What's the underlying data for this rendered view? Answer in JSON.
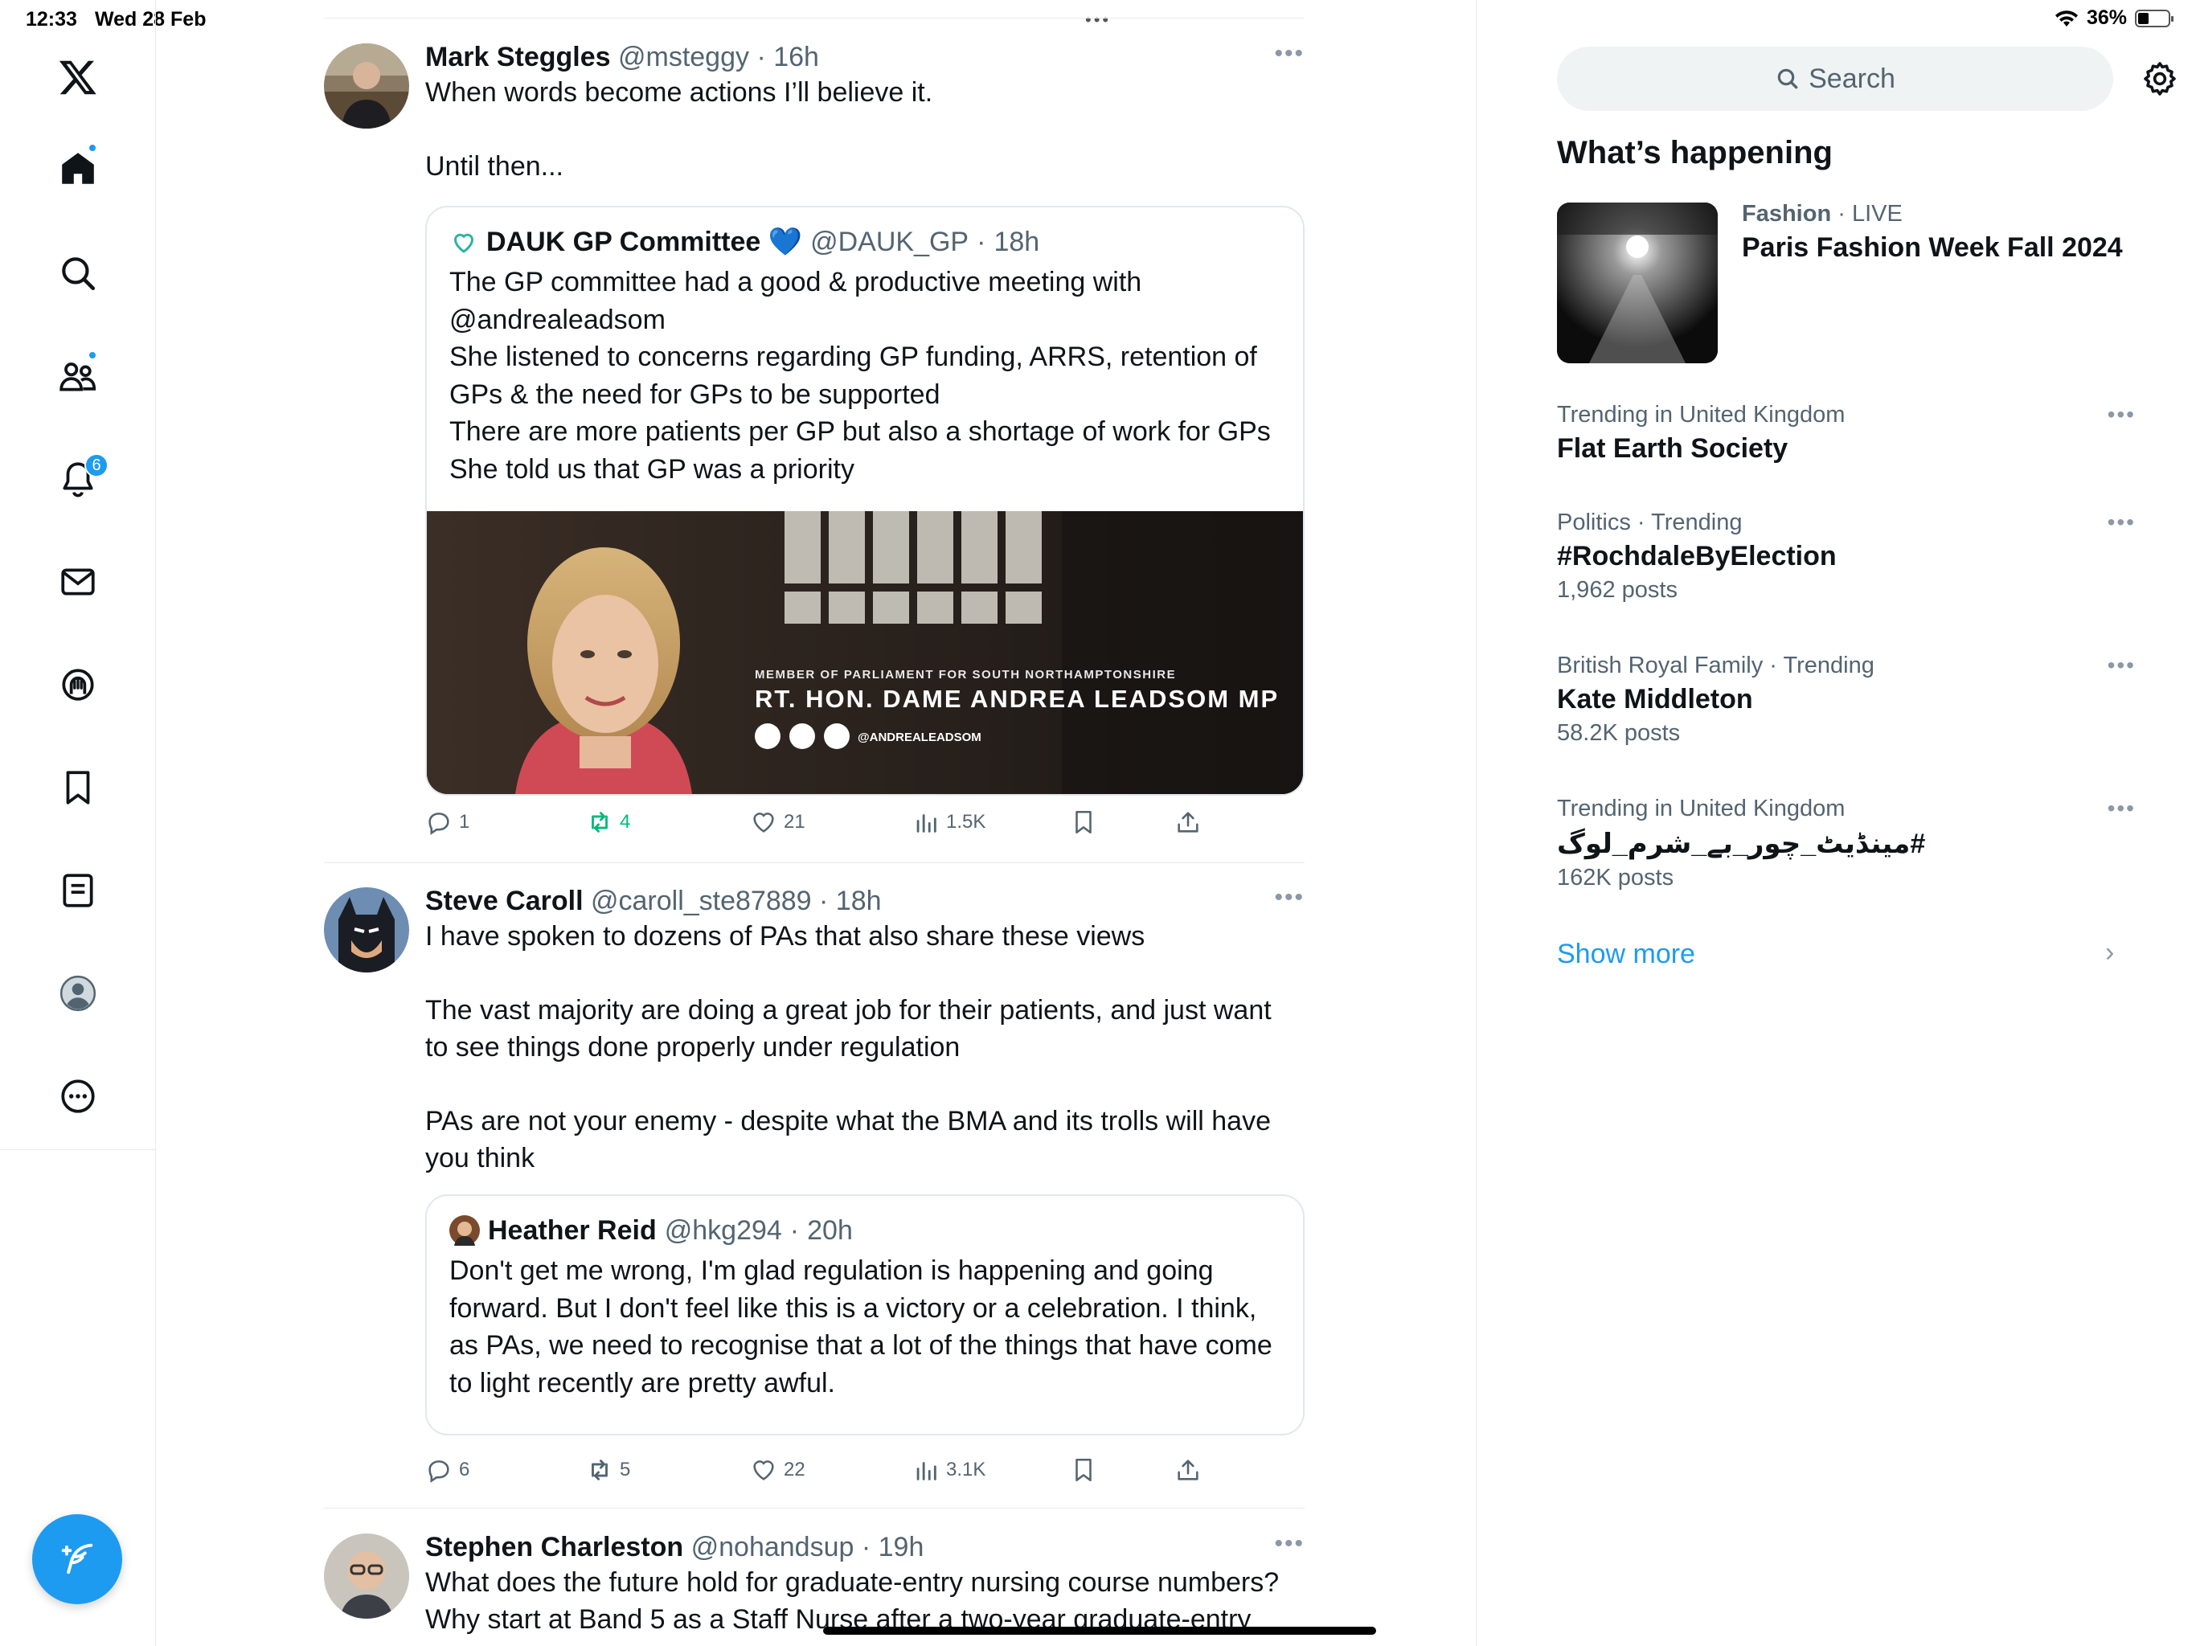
{
  "status_bar": {
    "time": "12:33",
    "date": "Wed 28 Feb",
    "battery": "36%",
    "battery_level": 0.36
  },
  "nav": {
    "items": [
      "x-logo",
      "home",
      "explore",
      "communities",
      "notifications",
      "messages",
      "spaces",
      "bookmarks",
      "lists",
      "profile",
      "more"
    ],
    "notifications_count": "6"
  },
  "feed": {
    "tweets": [
      {
        "name": "Mark Steggles",
        "handle": "@msteggy",
        "time": "16h",
        "text": "When words become actions I’ll believe it.\n\nUntil then...",
        "quote": {
          "name": "DAUK GP Committee 💙",
          "handle": "@DAUK_GP",
          "time": "18h",
          "text": "The GP committee had a good & productive meeting with\n@andrealeadsom\nShe listened to concerns regarding GP funding, ARRS, retention of\nGPs & the need for GPs to be supported\nThere are more patients per GP but also a shortage of work for GPs\nShe told us that GP was a priority",
          "image": {
            "caption_small": "MEMBER OF PARLIAMENT FOR SOUTH NORTHAMPTONSHIRE",
            "caption_big": "RT. HON. DAME ANDREA LEADSOM MP",
            "caption_handle": "@ANDREALEADSOM"
          }
        },
        "replies": "1",
        "reposts": "4",
        "likes": "21",
        "views": "1.5K"
      },
      {
        "name": "Steve Caroll",
        "handle": "@caroll_ste87889",
        "time": "18h",
        "text": "I have spoken to dozens of PAs that also share these views\n\nThe vast majority are doing a great job for their patients, and just want\nto see things done properly under regulation\n\nPAs are not your enemy - despite what the BMA and its trolls will have\nyou think",
        "quote": {
          "name": "Heather Reid",
          "handle": "@hkg294",
          "time": "20h",
          "text": "Don't get me wrong, I'm glad regulation is happening and going\nforward. But I don't feel like this is a victory or a celebration. I think,\nas PAs, we need to recognise that a lot of the things that have come\nto light recently are pretty awful."
        },
        "replies": "6",
        "reposts": "5",
        "likes": "22",
        "views": "3.1K"
      },
      {
        "name": "Stephen Charleston",
        "handle": "@nohandsup",
        "time": "19h",
        "text": "What does the future hold for graduate-entry nursing course numbers?\nWhy start at Band 5 as a Staff Nurse after a two-year graduate-entry"
      }
    ]
  },
  "sidebar": {
    "search_placeholder": "Search",
    "section_title": "What’s happening",
    "featured": {
      "category": "Fashion",
      "live": "LIVE",
      "title": "Paris Fashion Week Fall 2024"
    },
    "trends": [
      {
        "meta": "Trending in United Kingdom",
        "title": "Flat Earth Society",
        "count": ""
      },
      {
        "meta": "Politics · Trending",
        "title": "#RochdaleByElection",
        "count": "1,962 posts"
      },
      {
        "meta": "British Royal Family · Trending",
        "title": "Kate Middleton",
        "count": "58.2K posts"
      },
      {
        "meta": "Trending in United Kingdom",
        "title": "#مینڈیٹ_چور_بے_شرم_لوگ",
        "count": "162K posts"
      }
    ],
    "show_more": "Show more"
  },
  "colors": {
    "accent": "#1d9bf0",
    "repost_active": "#00ba7c",
    "muted_text": "#536471"
  }
}
